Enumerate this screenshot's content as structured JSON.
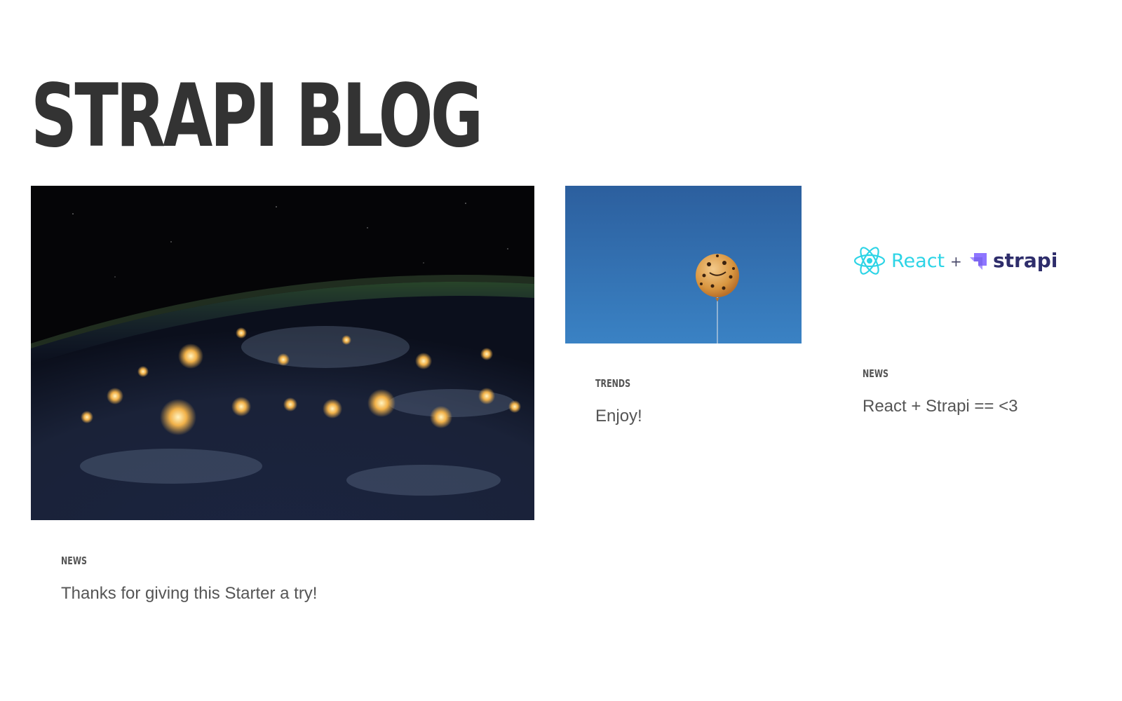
{
  "site": {
    "title": "Strapi Blog"
  },
  "articles": [
    {
      "category": "news",
      "title": "Thanks for giving this Starter a try!",
      "image": "earth-at-night-from-space"
    },
    {
      "category": "trends",
      "title": "Enjoy!",
      "image": "cookie-balloon-in-blue-sky"
    },
    {
      "category": "news",
      "title": "React + Strapi == <3",
      "image": "react-plus-strapi-logos",
      "image_text": {
        "react": "React",
        "plus": "+",
        "strapi": "strapi"
      }
    }
  ],
  "colors": {
    "title": "#333333",
    "text": "#555555",
    "react": "#2dd4e6",
    "strapi": "#2e2d6b",
    "strapi_logo": "#8e75ff",
    "sky": "#2f6fb0"
  }
}
